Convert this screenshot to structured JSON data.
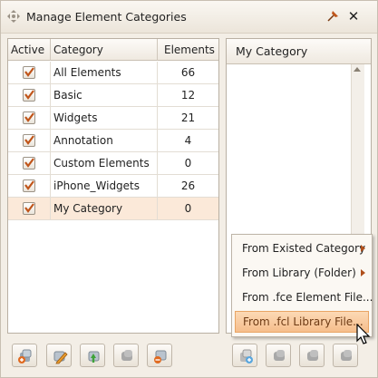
{
  "window": {
    "title": "Manage Element Categories",
    "icons": [
      "move-grip-icon",
      "pin-icon",
      "close-icon"
    ]
  },
  "table": {
    "headers": [
      "Active",
      "Category",
      "Elements"
    ],
    "rows": [
      {
        "active": true,
        "category": "All Elements",
        "elements": "66"
      },
      {
        "active": true,
        "category": "Basic",
        "elements": "12"
      },
      {
        "active": true,
        "category": "Widgets",
        "elements": "21"
      },
      {
        "active": true,
        "category": "Annotation",
        "elements": "4"
      },
      {
        "active": true,
        "category": "Custom Elements",
        "elements": "0"
      },
      {
        "active": true,
        "category": "iPhone_Widgets",
        "elements": "26"
      },
      {
        "active": true,
        "category": "My Category",
        "elements": "0",
        "selected": true
      }
    ]
  },
  "right_panel": {
    "header": "My Category"
  },
  "context_menu": {
    "items": [
      {
        "label": "From Existed Category",
        "submenu": true
      },
      {
        "label": "From Library (Folder)",
        "submenu": true
      },
      {
        "label": "From .fce Element File...",
        "submenu": false
      },
      {
        "label": "From .fcl Library File...",
        "submenu": false,
        "highlighted": true
      }
    ]
  },
  "toolbar_left": {
    "buttons": [
      "add-category-icon",
      "edit-category-icon",
      "move-up-icon",
      "disabled-icon",
      "delete-category-icon"
    ]
  },
  "toolbar_right": {
    "buttons": [
      "add-element-icon",
      "disabled-icon",
      "disabled-icon",
      "disabled-icon"
    ]
  },
  "colors": {
    "accent": "#f6be8c",
    "selected_row": "#fbe9d9",
    "check": "#c0551a"
  }
}
